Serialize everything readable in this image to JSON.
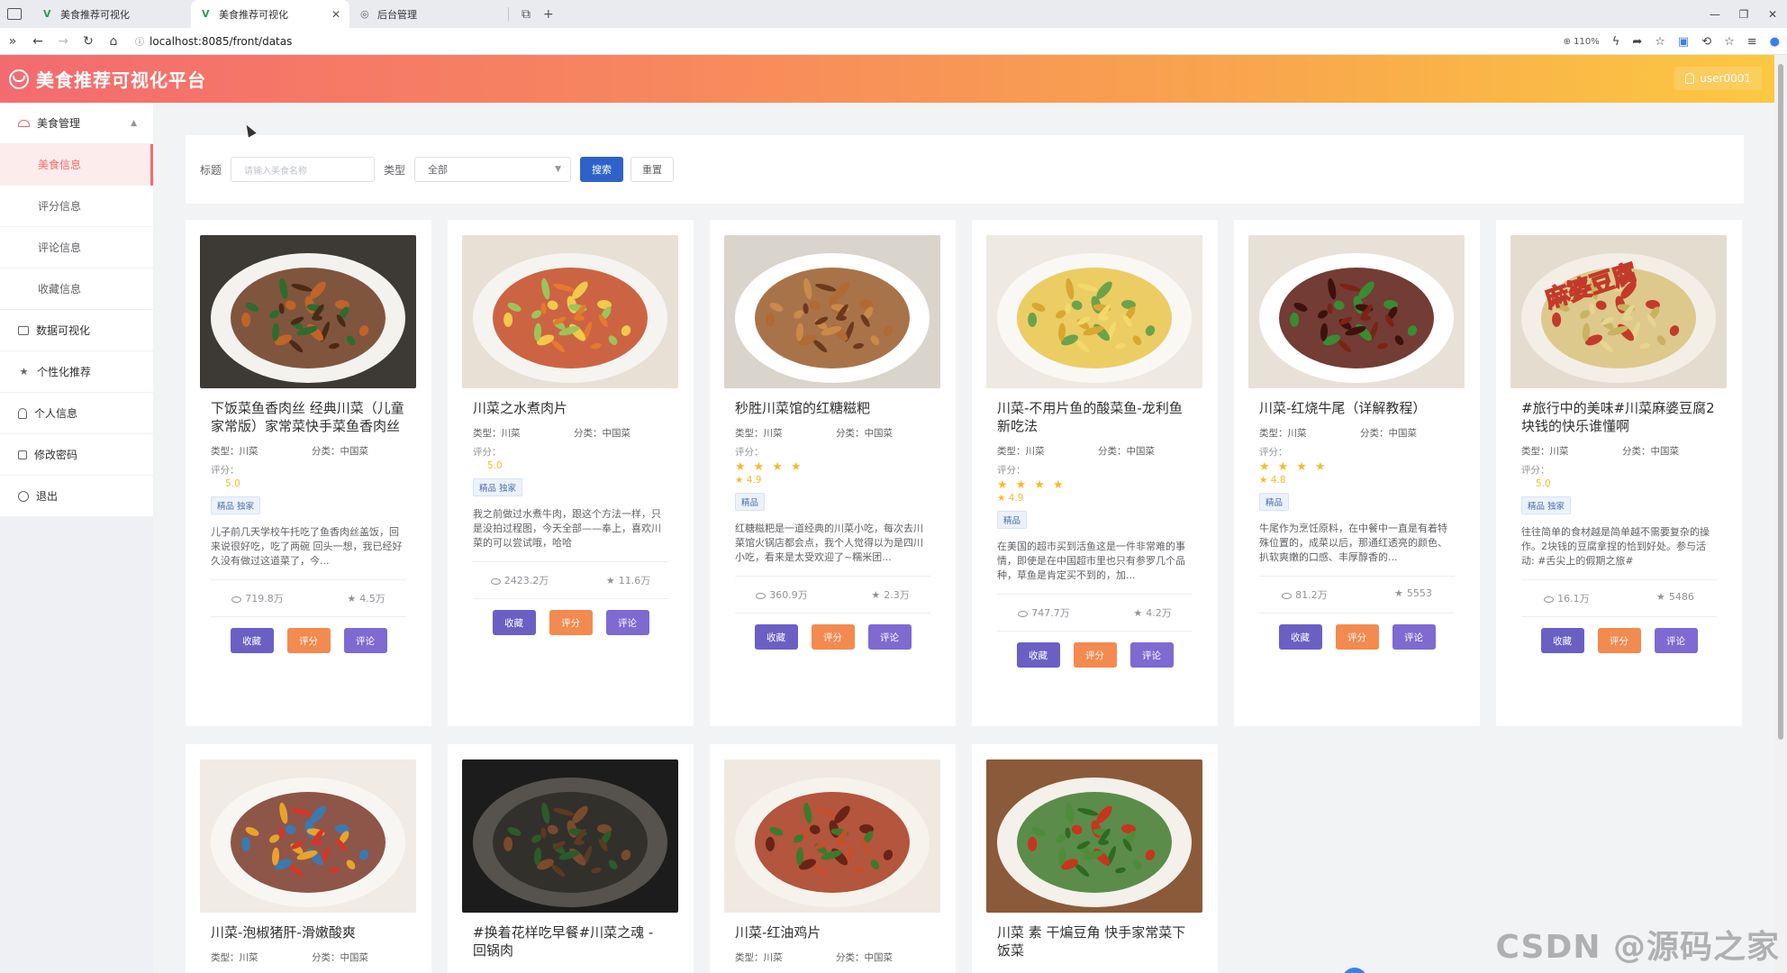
{
  "browser": {
    "tabs": [
      {
        "label": "美食推荐可视化"
      },
      {
        "label": "美食推荐可视化"
      },
      {
        "label": "后台管理"
      }
    ],
    "url": "localhost:8085/front/datas",
    "zoom": "110%"
  },
  "header": {
    "title": "美食推荐可视化平台",
    "user": "user0001"
  },
  "sidebar": {
    "group": "美食管理",
    "subitems": [
      "美食信息",
      "评分信息",
      "评论信息",
      "收藏信息"
    ],
    "items": [
      "数据可视化",
      "个性化推荐",
      "个人信息",
      "修改密码",
      "退出"
    ]
  },
  "search": {
    "title_label": "标题",
    "title_placeholder": "请输入美食名称",
    "type_label": "类型",
    "type_value": "全部",
    "search_btn": "搜索",
    "reset_btn": "重置"
  },
  "labels": {
    "type_prefix": "类型：",
    "cat_prefix": "分类：",
    "rating": "评分：",
    "fav": "收藏",
    "rate": "评分",
    "comment": "评论"
  },
  "cards": [
    {
      "title": "下饭菜鱼香肉丝 经典川菜（儿童家常版）家常菜快手菜鱼香肉丝",
      "type": "川菜",
      "category": "中国菜",
      "rating_text": "5.0",
      "stars": false,
      "tag": "精品 独家",
      "desc": "儿子前几天学校午托吃了鱼香肉丝盖饭，回来说很好吃，吃了两碗 回头一想，我已经好久没有做过这道菜了，今...",
      "views": "719.8万",
      "favs": "4.5万"
    },
    {
      "title": "川菜之水煮肉片",
      "type": "川菜",
      "category": "中国菜",
      "rating_text": "5.0",
      "stars": false,
      "tag": "精品 独家",
      "desc": "我之前做过水煮牛肉，跟这个方法一样，只是没拍过程图，今天全部——奉上，喜欢川菜的可以尝试哦，哈哈",
      "views": "2423.2万",
      "favs": "11.6万"
    },
    {
      "title": "秒胜川菜馆的红糖糍粑",
      "type": "川菜",
      "category": "中国菜",
      "rating_text": "4.9",
      "stars": true,
      "tag": "精品",
      "desc": "红糖糍粑是一道经典的川菜小吃，每次去川菜馆火锅店都会点，我个人觉得以为是四川小吃，看来是太受欢迎了~糯米团...",
      "views": "360.9万",
      "favs": "2.3万"
    },
    {
      "title": "川菜-不用片鱼的酸菜鱼-龙利鱼新吃法",
      "type": "川菜",
      "category": "中国菜",
      "rating_text": "4.9",
      "stars": true,
      "tag": "精品",
      "desc": "在美国的超市买到活鱼这是一件非常难的事情，即使是在中国超市里也只有参罗几个品种，草鱼是肯定买不到的，加...",
      "views": "747.7万",
      "favs": "4.2万"
    },
    {
      "title": "川菜-红烧牛尾（详解教程）",
      "type": "川菜",
      "category": "中国菜",
      "rating_text": "4.8",
      "stars": true,
      "tag": "精品",
      "desc": "牛尾作为烹饪原料，在中餐中一直是有着特殊位置的，成菜以后，那通红透亮的颜色、扒软爽嫩的口感、丰厚醇香的...",
      "views": "81.2万",
      "favs": "5553"
    },
    {
      "title": "#旅行中的美味#川菜麻婆豆腐2块钱的快乐谁懂啊",
      "type": "川菜",
      "category": "中国菜",
      "rating_text": "5.0",
      "stars": false,
      "tag": "精品 独家",
      "desc": "往往简单的食材越是简单越不需要复杂的操作。2块钱的豆腐拿捏的恰到好处。参与活动: #舌尖上的假期之旅#",
      "views": "16.1万",
      "favs": "5486"
    },
    {
      "title": "川菜-泡椒猪肝-滑嫩酸爽",
      "type": "川菜",
      "category": "中国菜"
    },
    {
      "title": "#换着花样吃早餐#川菜之魂 - 回锅肉",
      "type": "",
      "category": ""
    },
    {
      "title": "川菜-红油鸡片",
      "type": "川菜",
      "category": "中国菜"
    },
    {
      "title": "川菜 素 干煸豆角 快手家常菜下饭菜",
      "type": "",
      "category": ""
    }
  ],
  "image_overlay_text": "麻婆豆腐",
  "watermark": "CSDN @源码之家"
}
